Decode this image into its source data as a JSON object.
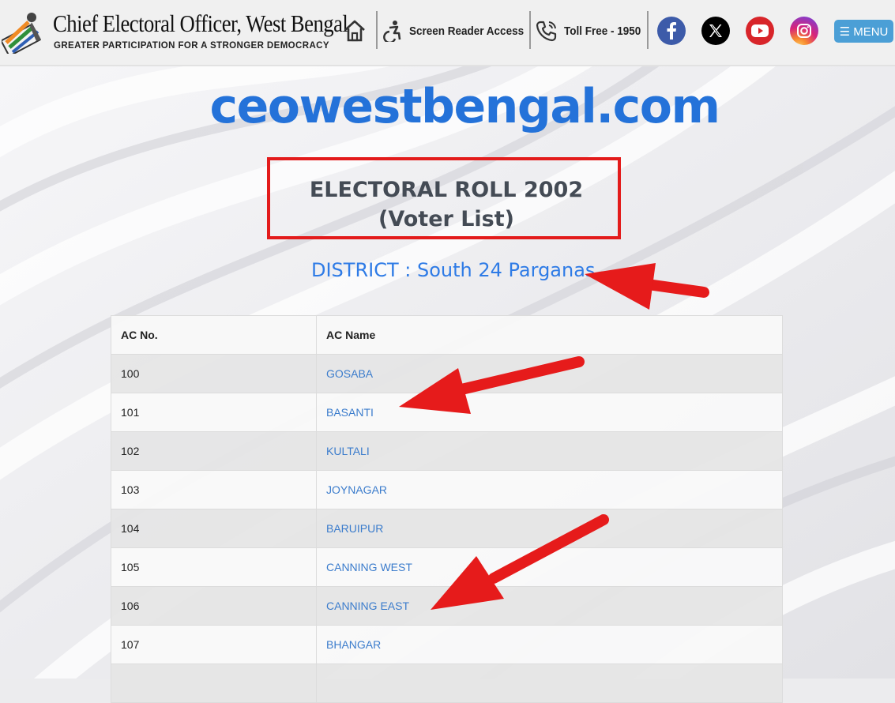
{
  "header": {
    "title": "Chief Electoral Officer, West Bengal",
    "tagline": "GREATER PARTICIPATION FOR A STRONGER DEMOCRACY",
    "screen_reader_label": "Screen Reader Access",
    "toll_free_label": "Toll Free - 1950",
    "menu_label": "☰ MENU",
    "icons": [
      "home-icon",
      "accessibility-icon",
      "phone-icon",
      "facebook-icon",
      "x-icon",
      "youtube-icon",
      "instagram-icon"
    ]
  },
  "main": {
    "site_name": "ceowestbengal.com",
    "roll_title_line1": "ELECTORAL ROLL 2002",
    "roll_title_line2": "(Voter List)",
    "district": "DISTRICT : South 24 Parganas"
  },
  "table": {
    "headers": [
      "AC No.",
      "AC Name"
    ],
    "rows": [
      {
        "no": "100",
        "name": "GOSABA"
      },
      {
        "no": "101",
        "name": "BASANTI"
      },
      {
        "no": "102",
        "name": "KULTALI"
      },
      {
        "no": "103",
        "name": "JOYNAGAR"
      },
      {
        "no": "104",
        "name": "BARUIPUR"
      },
      {
        "no": "105",
        "name": "CANNING WEST"
      },
      {
        "no": "106",
        "name": "CANNING EAST"
      },
      {
        "no": "107",
        "name": "BHANGAR"
      }
    ]
  },
  "colors": {
    "link": "#3b7ccc",
    "site_name": "#2472d9",
    "annotation_red": "#e31b1b",
    "menu_button": "#4b9fd6"
  }
}
